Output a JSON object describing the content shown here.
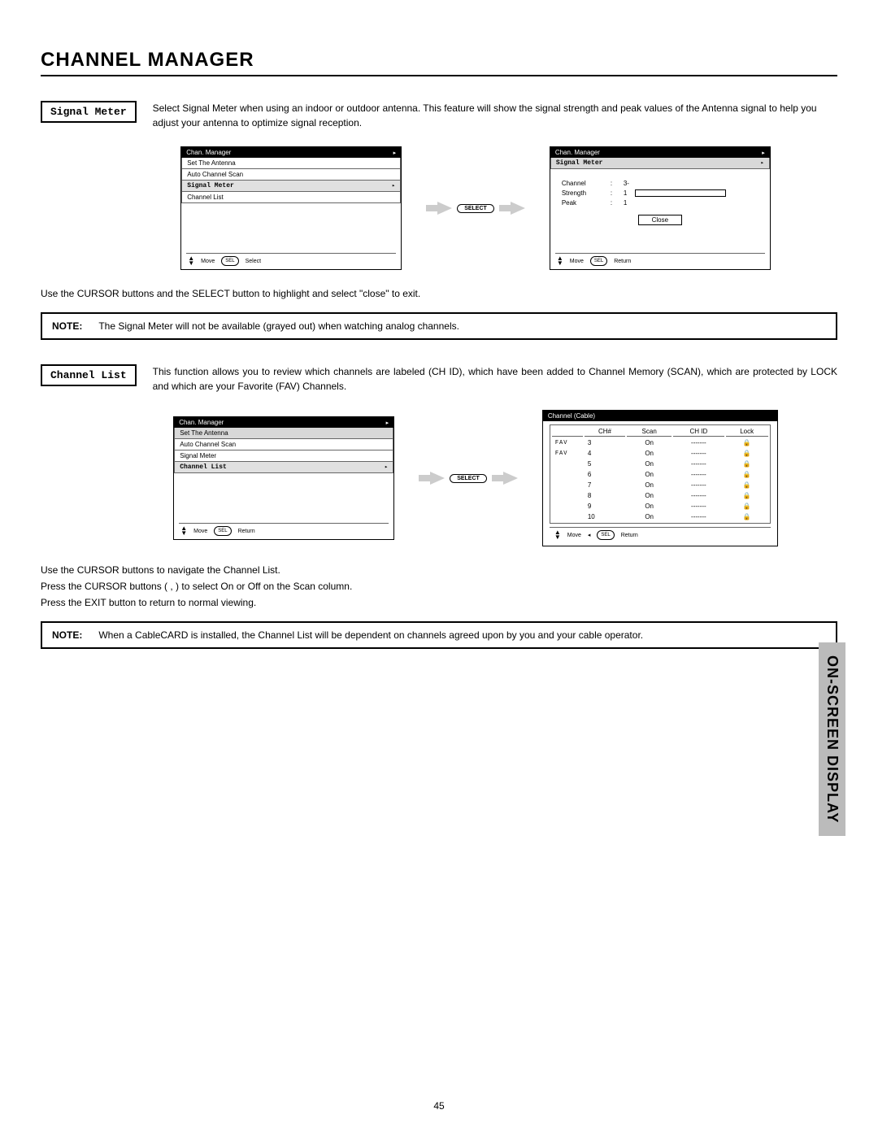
{
  "page_title": "CHANNEL MANAGER",
  "signal_meter": {
    "label": "Signal Meter",
    "desc": "Select Signal Meter when using an indoor or outdoor antenna.  This feature will show the signal strength and peak values of the Antenna signal to help  you adjust your antenna to optimize signal reception.",
    "menu_left_title": "Chan. Manager",
    "menu_left_items": [
      "Set The Antenna",
      "Auto Channel Scan",
      "Signal Meter",
      "Channel List"
    ],
    "hint_move": "Move",
    "hint_sel": "SEL",
    "hint_select": "Select",
    "select_btn": "SELECT",
    "menu_right_title": "Chan. Manager",
    "menu_right_sub": "Signal Meter",
    "channel_label": "Channel",
    "channel_val": "3-",
    "strength_label": "Strength",
    "strength_val": "1",
    "peak_label": "Peak",
    "peak_val": "1",
    "close_label": "Close",
    "hint_return": "Return",
    "post_text": "Use the CURSOR buttons and the SELECT button to highlight and select \"close\" to exit.",
    "note_label": "NOTE:",
    "note_text": "The Signal Meter will not be available (grayed out) when watching analog channels."
  },
  "channel_list": {
    "label": "Channel List",
    "desc": "This function allows you to review which channels are labeled (CH ID), which have been added to Channel Memory (SCAN), which are protected by LOCK and which are your Favorite (FAV) Channels.",
    "menu_left_title": "Chan. Manager",
    "menu_left_items": [
      "Set The Antenna",
      "Auto Channel Scan",
      "Signal Meter",
      "Channel List"
    ],
    "hint_move": "Move",
    "hint_sel": "SEL",
    "hint_return": "Return",
    "select_btn": "SELECT",
    "table_title": "Channel (Cable)",
    "cols": {
      "ch": "CH#",
      "scan": "Scan",
      "chid": "CH ID",
      "lock": "Lock"
    },
    "rows": [
      {
        "fav": "FAV",
        "ch": "3",
        "scan": "On",
        "chid": "-------",
        "lock": true
      },
      {
        "fav": "FAV",
        "ch": "4",
        "scan": "On",
        "chid": "-------",
        "lock": true
      },
      {
        "fav": "",
        "ch": "5",
        "scan": "On",
        "chid": "-------",
        "lock": true
      },
      {
        "fav": "",
        "ch": "6",
        "scan": "On",
        "chid": "-------",
        "lock": true
      },
      {
        "fav": "",
        "ch": "7",
        "scan": "On",
        "chid": "-------",
        "lock": true
      },
      {
        "fav": "",
        "ch": "8",
        "scan": "On",
        "chid": "-------",
        "lock": true
      },
      {
        "fav": "",
        "ch": "9",
        "scan": "On",
        "chid": "-------",
        "lock": true
      },
      {
        "fav": "",
        "ch": "10",
        "scan": "On",
        "chid": "-------",
        "lock": true
      }
    ],
    "post_text_1": "Use the CURSOR buttons to navigate the Channel List.",
    "post_text_2": "Press the CURSOR buttons (   ,   ) to select On or Off on the Scan column.",
    "post_text_3": "Press the EXIT button to return to normal viewing.",
    "note_label": "NOTE:",
    "note_text": "When a CableCARD is installed, the Channel List will be dependent on channels agreed upon by you and your cable operator."
  },
  "side_tab": "ON-SCREEN DISPLAY",
  "page_number": "45"
}
